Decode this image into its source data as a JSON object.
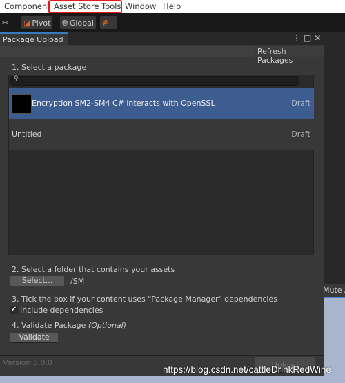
{
  "menubar": {
    "items": [
      "Component",
      "Asset Store Tools",
      "Window",
      "Help"
    ],
    "highlight_color": "#e8191a"
  },
  "toolbar": {
    "pivot": "Pivot",
    "global": "Global"
  },
  "window": {
    "tab": "Package Upload",
    "refresh": "Refresh Packages"
  },
  "step1": {
    "label": "1. Select a package",
    "search_value": "",
    "packages": [
      {
        "name": "Encryption SM2-SM4 C# interacts with OpenSSL",
        "status": "Draft",
        "selected": true
      },
      {
        "name": "Untitled",
        "status": "Draft",
        "selected": false
      }
    ]
  },
  "step2": {
    "label": "2. Select a folder that contains your assets",
    "button": "Select...",
    "path": "/SM"
  },
  "step3": {
    "label": "3. Tick the box if your content uses \"Package Manager\" dependencies",
    "checkbox": "Include dependencies",
    "checked": true
  },
  "step4": {
    "label": "4. Validate Package ",
    "optional": "(Optional)",
    "button": "Validate"
  },
  "footer": {
    "version": "Version 5.0.0",
    "upload": "Upload"
  },
  "side": {
    "mute": "Mute A"
  },
  "watermark": "https://blog.csdn.net/cattleDrinkRedWine",
  "accent": "#3d5d91"
}
